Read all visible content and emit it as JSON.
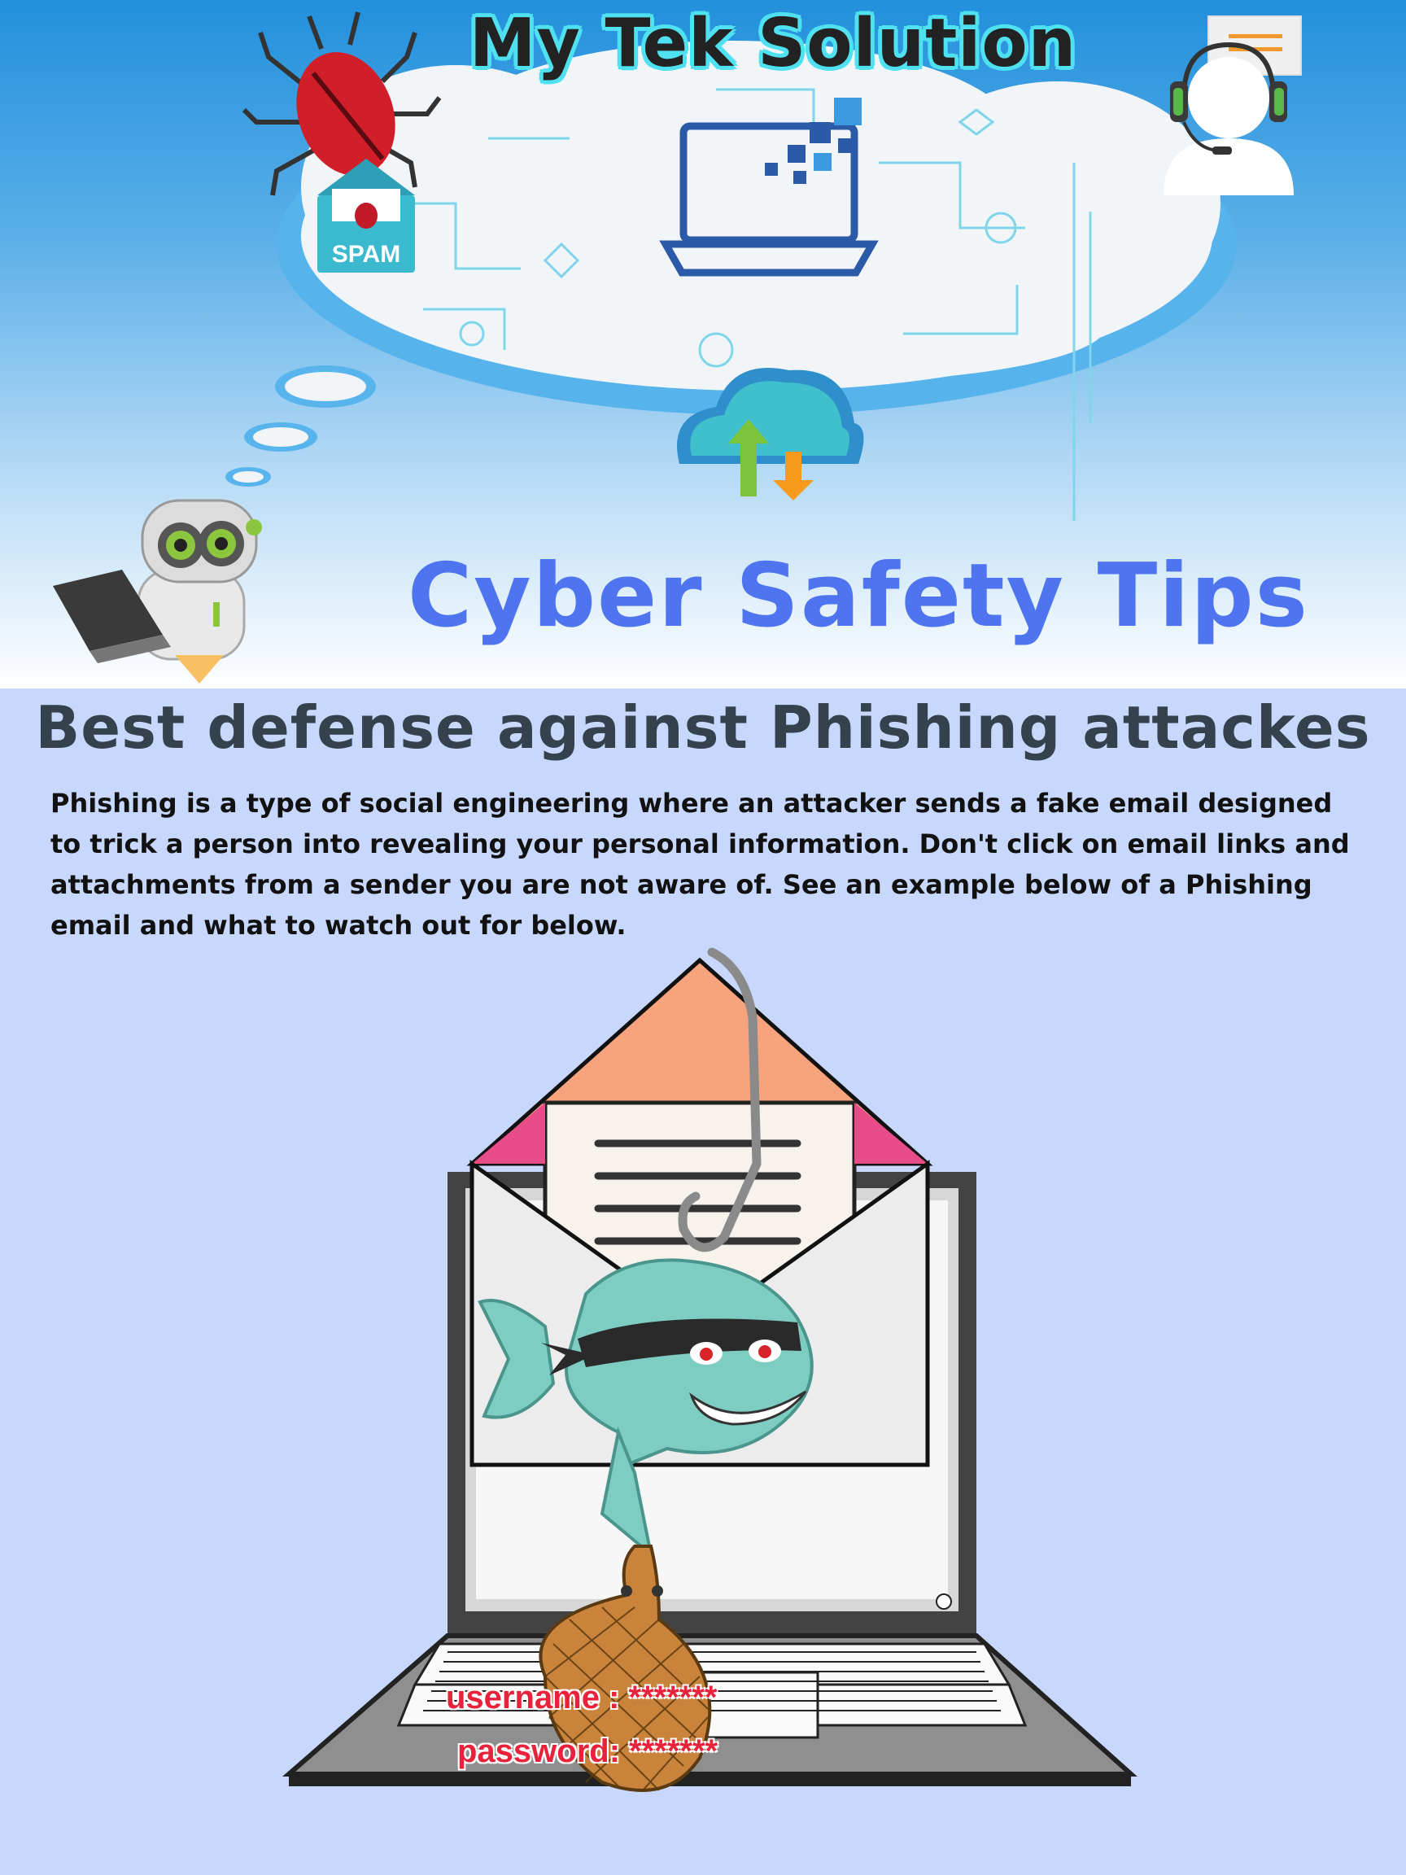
{
  "header": {
    "brand_title": "My Tek Solution",
    "hero_title": "Cyber Safety Tips",
    "spam_label": "SPAM"
  },
  "article": {
    "heading": "Best defense against Phishing attackes",
    "intro": "Phishing is a type of social engineering where an attacker sends a fake email designed to trick a person into revealing your personal information. Don't click on email links and attachments from a sender you are not aware of. See an example below of a Phishing email and what to watch out for below."
  },
  "illustration": {
    "username_text": "username : *******",
    "password_text": "password: *******"
  },
  "colors": {
    "hero_title": "#4f74f0",
    "heading": "#33424d",
    "page_bg": "#c8d8fc",
    "brand_outline": "#4fe1f0",
    "fish": "#7ecdc2",
    "envelope_top": "#f7a37e",
    "net": "#c9833a",
    "credential": "#e8223a"
  },
  "icons": [
    "bug-icon",
    "spam-envelope-icon",
    "laptop-icon",
    "cloud-transfer-icon",
    "support-agent-icon",
    "robot-icon",
    "phishing-fish-icon",
    "fishing-hook-icon",
    "net-bag-icon"
  ]
}
